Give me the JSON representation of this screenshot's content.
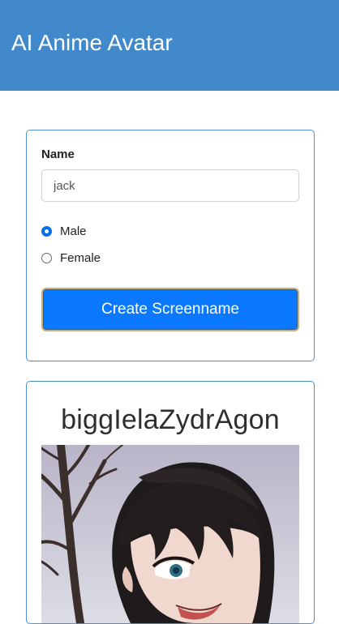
{
  "header": {
    "title": "AI Anime Avatar"
  },
  "form": {
    "name_label": "Name",
    "name_value": "jack",
    "gender_options": [
      {
        "label": "Male",
        "selected": true
      },
      {
        "label": "Female",
        "selected": false
      }
    ],
    "submit_label": "Create Screenname"
  },
  "result": {
    "screenname": "biggIelaZydrAgon",
    "avatar": {
      "description_icon": "anime-avatar-image"
    }
  },
  "colors": {
    "header_bg": "#4189cb",
    "card_border": "#4a8fd0",
    "button_bg": "#0a78ff",
    "radio_accent": "#0b6ee6"
  }
}
